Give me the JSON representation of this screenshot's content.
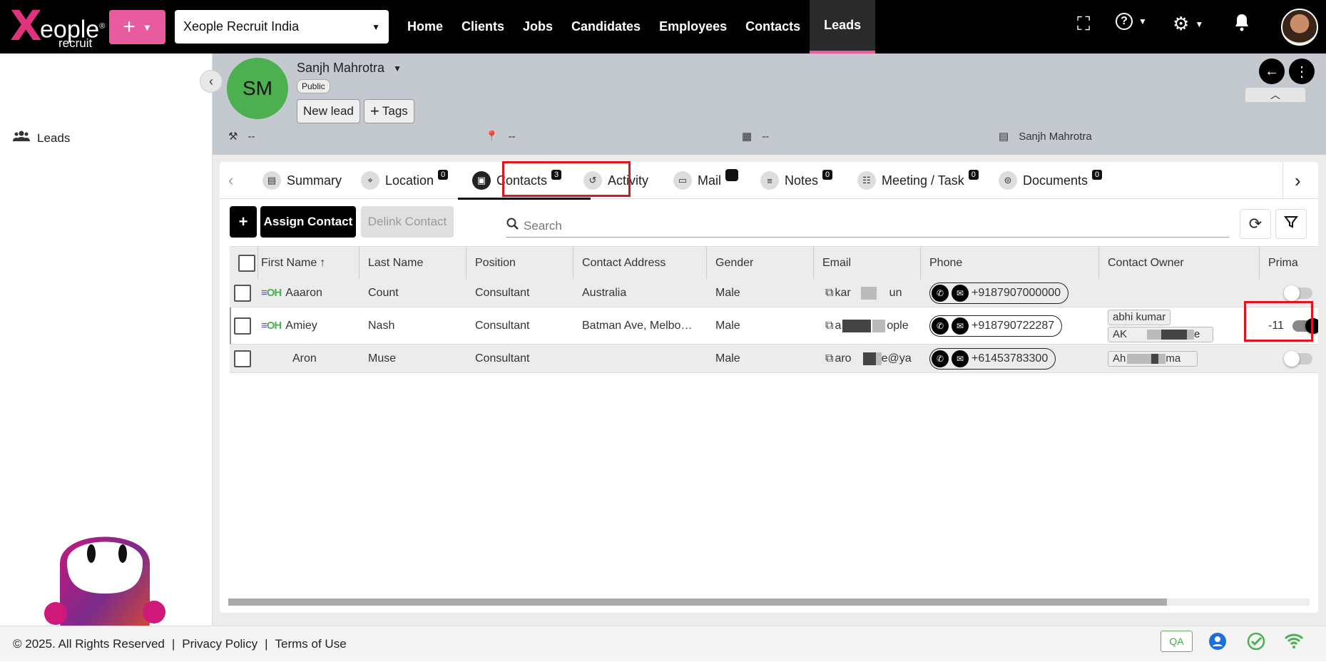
{
  "app": {
    "logo_text": "Xeople",
    "logo_sub": "recruit",
    "org": "Xeople Recruit India"
  },
  "nav": [
    "Home",
    "Clients",
    "Jobs",
    "Candidates",
    "Employees",
    "Contacts",
    "Leads"
  ],
  "nav_active": "Leads",
  "colors": {
    "brand_pink": "#e85c9f",
    "avatar_green": "#4caf50",
    "highlight_red": "#e1131e"
  },
  "sidebar": {
    "item": "Leads"
  },
  "lead": {
    "initials": "SM",
    "name": "Sanjh Mahrotra",
    "visibility": "Public",
    "status_btn": "New lead",
    "tags_btn": "Tags",
    "meta": [
      "--",
      "--",
      "--",
      "Sanjh Mahrotra"
    ]
  },
  "tabs": [
    {
      "label": "Summary",
      "icon": "summary-icon"
    },
    {
      "label": "Location",
      "badge": "0",
      "icon": "location-icon"
    },
    {
      "label": "Contacts",
      "badge": "3",
      "icon": "contacts-icon"
    },
    {
      "label": "Activity",
      "icon": "activity-icon"
    },
    {
      "label": "Mail",
      "badge": "",
      "icon": "mail-icon"
    },
    {
      "label": "Notes",
      "badge": "0",
      "icon": "notes-icon"
    },
    {
      "label": "Meeting / Task",
      "badge": "0",
      "icon": "meeting-icon"
    },
    {
      "label": "Documents",
      "badge": "0",
      "icon": "documents-icon"
    }
  ],
  "toolbar": {
    "add": "+",
    "assign": "Assign Contact",
    "delink": "Delink Contact",
    "search_placeholder": "Search"
  },
  "columns": [
    "First Name",
    "Last Name",
    "Position",
    "Contact Address",
    "Gender",
    "Email",
    "Phone",
    "Contact Owner",
    "Prima"
  ],
  "rows": [
    {
      "first": "Aaaron",
      "last": "Count",
      "position": "Consultant",
      "address": "Australia",
      "gender": "Male",
      "email_a": "kar",
      "email_b": "un",
      "phone": "+9187907000000",
      "owner1": "",
      "owner2": "",
      "primary": false,
      "oh": true
    },
    {
      "first": "Amiey",
      "last": "Nash",
      "position": "Consultant",
      "address": "Batman Ave, Melbo…",
      "gender": "Male",
      "email_a": "a",
      "email_b": "ople",
      "phone": "+918790722287",
      "owner1": "abhi kumar",
      "owner2": "AK",
      "owner2_end": "e",
      "primary": true,
      "oh": true,
      "extra": "-11"
    },
    {
      "first": "Aron",
      "last": "Muse",
      "position": "Consultant",
      "address": "",
      "gender": "Male",
      "email_a": "aro",
      "email_b": "e@ya",
      "phone": "+61453783300",
      "owner1": "Ah",
      "owner1_end": "ma",
      "owner2": "",
      "primary": false,
      "oh": false
    }
  ],
  "footer": {
    "copyright": "© 2025. All Rights Reserved",
    "privacy": "Privacy Policy",
    "terms": "Terms of Use",
    "env": "QA"
  }
}
